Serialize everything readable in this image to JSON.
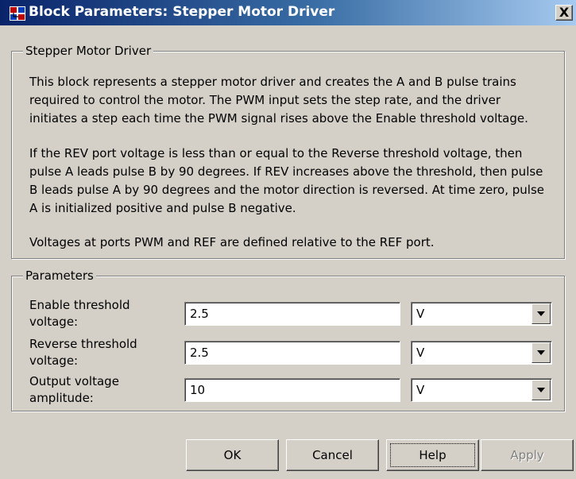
{
  "window": {
    "title": "Block Parameters: Stepper Motor Driver",
    "close_label": "X"
  },
  "description": {
    "group_title": "Stepper Motor Driver",
    "lines": [
      "This block represents a stepper motor driver and creates the A and B pulse trains",
      "required to control the motor. The PWM input sets the step rate, and the driver",
      "initiates a step each time the PWM signal rises above the Enable threshold voltage.",
      "If the REV port voltage is less than or equal to the Reverse threshold voltage, then",
      "pulse A leads pulse B by 90 degrees. If REV increases above the threshold, then pulse",
      "B leads pulse A by 90 degrees and the motor direction is reversed. At time zero, pulse",
      "A is initialized positive and pulse B negative.",
      "Voltages at ports PWM and REF are defined relative to the REF port."
    ]
  },
  "parameters": {
    "group_title": "Parameters",
    "rows": [
      {
        "label_line1": "Enable threshold",
        "label_line2": "voltage:",
        "value": "2.5",
        "unit": "V"
      },
      {
        "label_line1": "Reverse threshold",
        "label_line2": "voltage:",
        "value": "2.5",
        "unit": "V"
      },
      {
        "label_line1": "Output voltage",
        "label_line2": "amplitude:",
        "value": "10",
        "unit": "V"
      }
    ]
  },
  "buttons": {
    "ok": "OK",
    "cancel": "Cancel",
    "help": "Help",
    "apply": "Apply"
  }
}
